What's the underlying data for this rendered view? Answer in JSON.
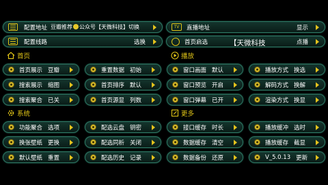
{
  "top": {
    "source_addr": {
      "label": "配置地址",
      "value_pre": "豆瓣推荐",
      "value_post": "公众号【天微科技】切换"
    },
    "live_addr": {
      "label": "直播地址",
      "value": "显示"
    },
    "source_line": {
      "label": "配置线路",
      "value": "选换"
    },
    "home_start": {
      "label": "首页启选",
      "value": "点播"
    },
    "overlay_text": "【天微科技"
  },
  "sections": {
    "home": "首页",
    "play": "播放",
    "system": "系统",
    "more": "更多"
  },
  "items": {
    "home_display": {
      "label": "首页展示",
      "value": "豆瓣"
    },
    "reset_data": {
      "label": "重置数据",
      "value": "初始"
    },
    "window_display": {
      "label": "窗口画面",
      "value": "默认"
    },
    "play_mode": {
      "label": "播放方式",
      "value": "换选"
    },
    "search_display": {
      "label": "搜索展示",
      "value": "缩图"
    },
    "home_sort": {
      "label": "首页排序",
      "value": "默认"
    },
    "window_preview": {
      "label": "窗口预览",
      "value": "开启"
    },
    "decode_mode": {
      "label": "解码方式",
      "value": "换解"
    },
    "search_aggregate": {
      "label": "搜索聚合",
      "value": "已关"
    },
    "home_source": {
      "label": "首页源显",
      "value": "列数"
    },
    "window_popup": {
      "label": "窗口弹幕",
      "value": "已开"
    },
    "render_mode": {
      "label": "渲染方式",
      "value": "换显"
    },
    "func_aggregate": {
      "label": "功能聚合",
      "value": "选项"
    },
    "cloud_config": {
      "label": "配选云盘",
      "value": "钥密"
    },
    "api_cache": {
      "label": "接口缓存",
      "value": "时长"
    },
    "play_buffer": {
      "label": "播放缓冲",
      "value": "选时"
    },
    "change_wallpaper": {
      "label": "换张壁纸",
      "value": "更换"
    },
    "config_sync": {
      "label": "配选同析",
      "value": "关闭"
    },
    "data_cache": {
      "label": "数据缓存",
      "value": "清空"
    },
    "play_cache": {
      "label": "播放缓存",
      "value": "截显"
    },
    "default_wallpaper": {
      "label": "默认壁纸",
      "value": "重置"
    },
    "config_history": {
      "label": "配选历史",
      "value": "记录"
    },
    "data_backup": {
      "label": "数据备份",
      "value": "还原"
    },
    "version": {
      "label": "V_5.0.13",
      "value": "更新"
    }
  },
  "colors": {
    "accent": "#e0c417",
    "pill_border": "#2e7a66",
    "pill_bg": "#14352d",
    "background": "#000000"
  }
}
